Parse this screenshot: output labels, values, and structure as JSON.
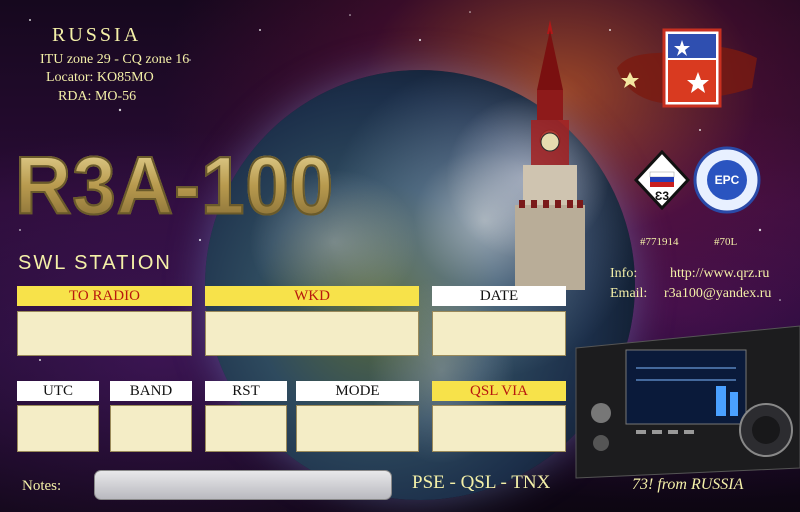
{
  "header": {
    "country": "RUSSIA",
    "zones": "ITU zone 29 - CQ zone 16",
    "locator": "Locator:  KO85MO",
    "rda": "RDA:  MO-56"
  },
  "callsign": "R3A-100",
  "station_type": "SWL  STATION",
  "badges": [
    {
      "label": "#771914"
    },
    {
      "label": "#70L"
    }
  ],
  "contact": {
    "info_label": "Info:",
    "info_value": "http://www.qrz.ru",
    "email_label": "Email:",
    "email_value": "r3a100@yandex.ru"
  },
  "fields_row1": [
    {
      "label": "TO  RADIO",
      "style": "yellow"
    },
    {
      "label": "WKD",
      "style": "yellow"
    },
    {
      "label": "DATE",
      "style": "white"
    }
  ],
  "fields_row2": [
    {
      "label": "UTC",
      "style": "white"
    },
    {
      "label": "BAND",
      "style": "white"
    },
    {
      "label": "RST",
      "style": "white"
    },
    {
      "label": "MODE",
      "style": "white"
    },
    {
      "label": "QSL VIA",
      "style": "yellow"
    }
  ],
  "notes_label": "Notes:",
  "closing": "PSE - QSL - TNX",
  "sign_off": "73!  from   RUSSIA",
  "colors": {
    "accent_yellow": "#f7e24a",
    "label_red": "#b8180e",
    "cell_fill": "#f4edc6",
    "text_yellow": "#f4f0a8"
  }
}
